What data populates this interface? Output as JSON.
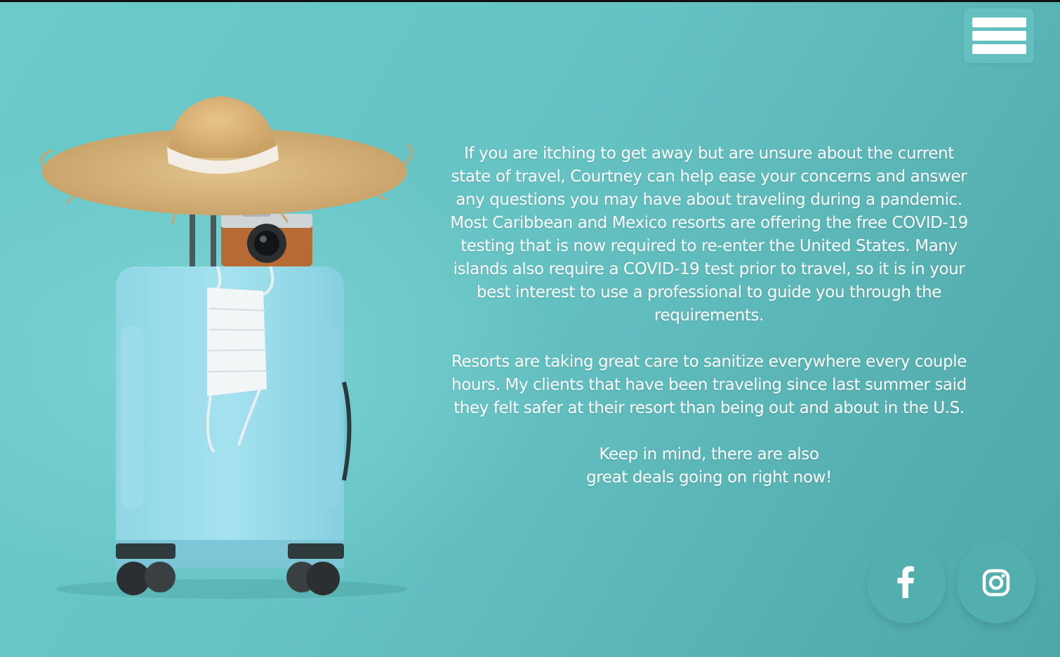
{
  "menu": {
    "icon": "hamburger-menu-icon"
  },
  "content": {
    "paragraph_1": "If you are itching to get away but are unsure about the current state of travel, Courtney can help ease your concerns and answer any questions you may have about traveling during a pandemic. Most Caribbean and Mexico resorts are offering the free COVID-19 testing that is now required to re-enter the United States. Many islands also require a COVID-19 test prior to travel, so it is in your best interest to use a professional to guide you through the requirements.",
    "paragraph_2": "Resorts are taking great care to sanitize everywhere every couple hours. My clients that have been traveling since last summer said they felt safer at their resort than being out and about in the U.S.",
    "paragraph_3_line_1": "Keep in mind, there are also",
    "paragraph_3_line_2": "great deals going on right now!"
  },
  "social": [
    {
      "icon": "facebook-icon"
    },
    {
      "icon": "instagram-icon"
    }
  ],
  "colors": {
    "background": "#66c3c4",
    "button": "#53aeae",
    "text": "#ffffff"
  }
}
